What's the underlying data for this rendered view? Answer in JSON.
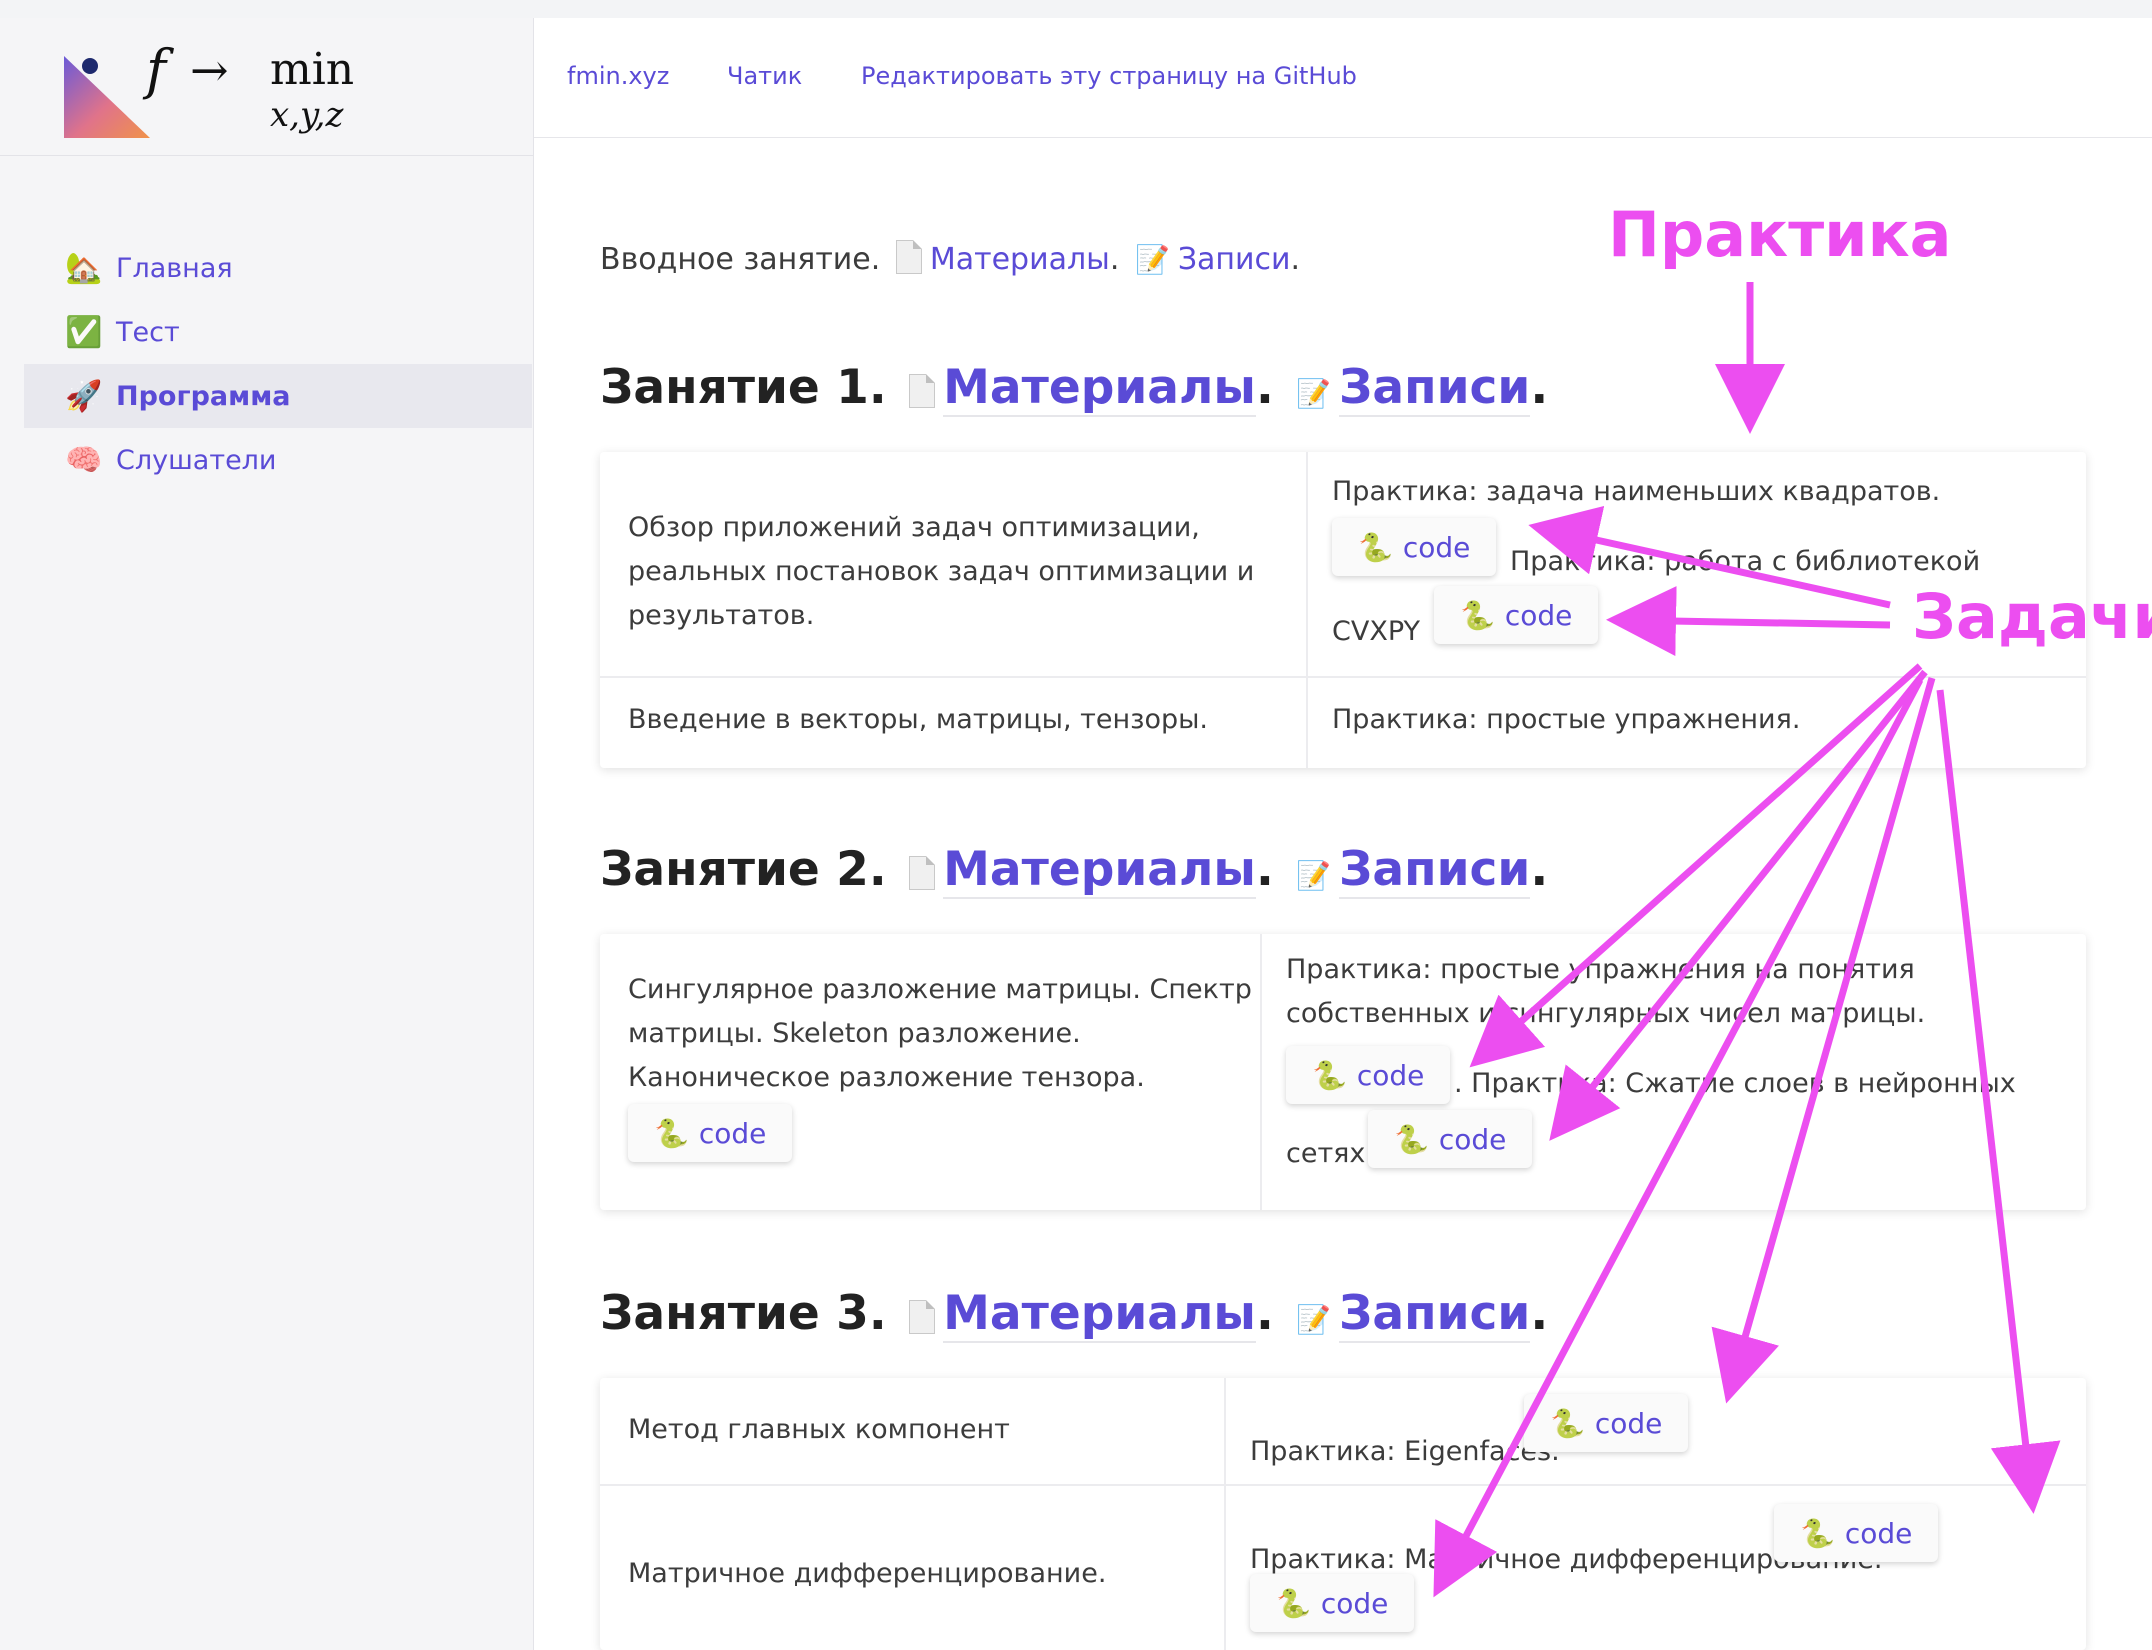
{
  "logo": {
    "f": "f",
    "arrow": "→",
    "min": "min",
    "sub": "x,y,z"
  },
  "header": {
    "links": [
      "fmin.xyz",
      "Чатик",
      "Редактировать эту страницу на GitHub"
    ]
  },
  "sidebar": {
    "items": [
      {
        "icon": "🏡",
        "label": "Главная"
      },
      {
        "icon": "✅",
        "label": "Тест"
      },
      {
        "icon": "🚀",
        "label": "Программа"
      },
      {
        "icon": "🧠",
        "label": "Слушатели"
      }
    ]
  },
  "intro": {
    "text": "Вводное занятие.",
    "materials": "Материалы",
    "notes": "Записи"
  },
  "lessons": [
    {
      "title": "Занятие 1.",
      "materials": "Материалы",
      "notes": "Записи",
      "rows": [
        {
          "left": "Обзор приложений задач оптимизации, реальных постановок задач оптимизации и результатов.",
          "right_a": "Практика: задача наименьших квадратов.",
          "right_b": "Практика: работа с библиотекой",
          "right_c": "CVXPY"
        },
        {
          "left": "Введение в векторы, матрицы, тензоры.",
          "right": "Практика: простые упражнения."
        }
      ]
    },
    {
      "title": "Занятие 2.",
      "materials": "Материалы",
      "notes": "Записи",
      "rows": [
        {
          "left_1": "Сингулярное разложение матрицы. Спектр",
          "left_2": "матрицы. Skeleton разложение.",
          "left_3": "Каноническое разложение тензора.",
          "right_1": "Практика: простые упражнения на понятия",
          "right_2": "собственных и сингулярных чисел матрицы.",
          "right_3": ". Практика: Сжатие слоев в нейронных",
          "right_4": "сетях"
        }
      ]
    },
    {
      "title": "Занятие 3.",
      "materials": "Материалы",
      "notes": "Записи",
      "rows": [
        {
          "left": "Метод главных компонент",
          "right": "Практика: Eigenfaces."
        },
        {
          "left": "Матричное дифференцирование.",
          "right": "Практика: Матричное дифференцирование."
        }
      ]
    }
  ],
  "code_label": "code",
  "code_icon": "🐍",
  "annotations": {
    "practice": "Практика",
    "tasks": "Задачи"
  },
  "colors": {
    "accent": "#5a4bd6",
    "annotation": "#ec4ef0"
  }
}
